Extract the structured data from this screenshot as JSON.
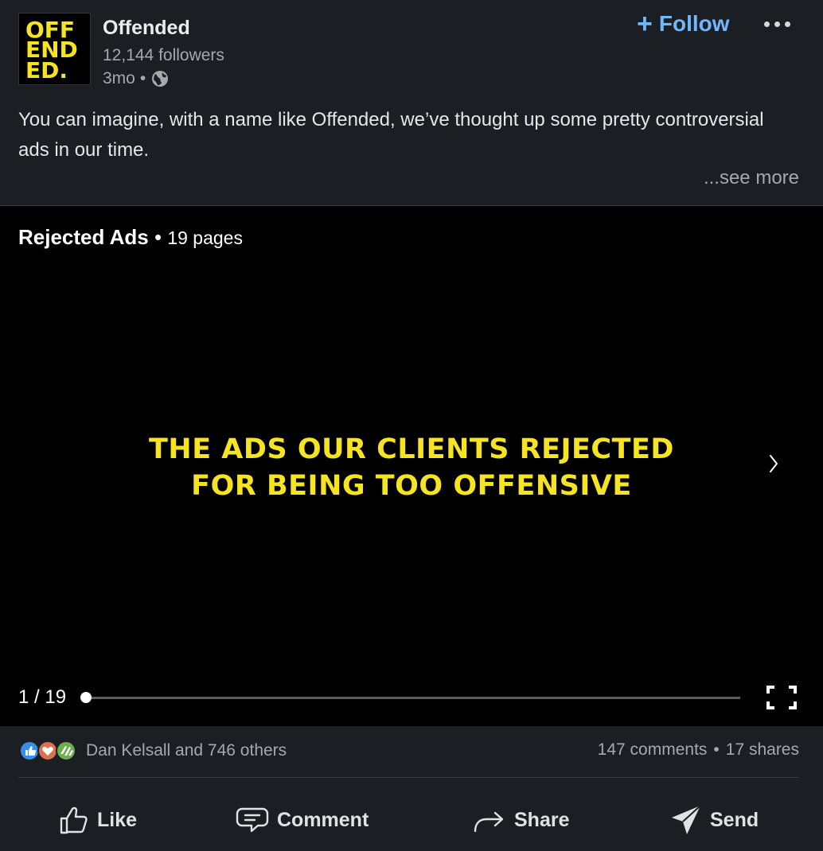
{
  "author": {
    "logo_lines": [
      "OFF",
      "END",
      "ED."
    ],
    "name": "Offended",
    "followers": "12,144 followers",
    "time": "3mo",
    "dot": "•",
    "visibility_icon": "globe-icon"
  },
  "header_actions": {
    "follow_plus": "+",
    "follow_label": "Follow",
    "more_icon": "ellipsis-icon"
  },
  "post": {
    "text": "You can imagine, with a name like Offended, we’ve thought up some pretty controversial ads in our time.",
    "see_more": "...see more"
  },
  "document": {
    "title": "Rejected Ads",
    "separator": " • ",
    "pages_label": "19 pages",
    "slide_line1": "THE ADS OUR CLIENTS REJECTED",
    "slide_line2": "FOR BEING TOO OFFENSIVE",
    "current_page_label": "1 / 19",
    "progress": 0.0,
    "next_icon": "chevron-right-icon",
    "fullscreen_icon": "fullscreen-icon"
  },
  "social": {
    "reaction_icons": [
      "like-icon",
      "love-icon",
      "support-icon"
    ],
    "reactions_text": "Dan Kelsall and 746 others",
    "comments": "147 comments",
    "dot": "•",
    "shares": "17 shares"
  },
  "actions": [
    {
      "label": "Like",
      "icon": "thumbs-up-icon"
    },
    {
      "label": "Comment",
      "icon": "comment-icon"
    },
    {
      "label": "Share",
      "icon": "share-arrow-icon"
    },
    {
      "label": "Send",
      "icon": "send-icon"
    }
  ],
  "colors": {
    "background": "#1b1f23",
    "link_blue": "#71b7fb",
    "slide_yellow": "#f5e41f",
    "muted_text": "#a6a8aa"
  }
}
